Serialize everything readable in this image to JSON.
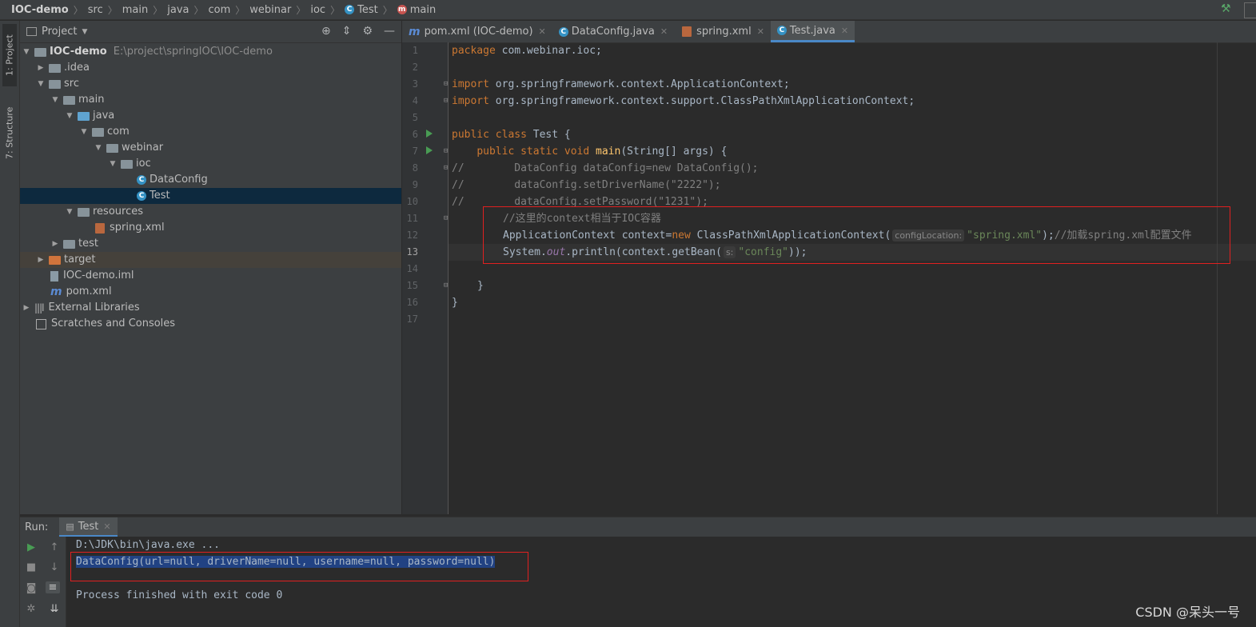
{
  "breadcrumb": {
    "items": [
      "IOC-demo",
      "src",
      "main",
      "java",
      "com",
      "webinar",
      "ioc",
      "Test",
      "main"
    ]
  },
  "toolstrip": {
    "project_tab": "1: Project",
    "structure_tab": "7: Structure"
  },
  "project_panel": {
    "title": "Project",
    "tree": [
      {
        "label": "IOC-demo",
        "path": "E:\\project\\springIOC\\IOC-demo"
      },
      {
        "label": ".idea"
      },
      {
        "label": "src"
      },
      {
        "label": "main"
      },
      {
        "label": "java"
      },
      {
        "label": "com"
      },
      {
        "label": "webinar"
      },
      {
        "label": "ioc"
      },
      {
        "label": "DataConfig"
      },
      {
        "label": "Test"
      },
      {
        "label": "resources"
      },
      {
        "label": "spring.xml"
      },
      {
        "label": "test"
      },
      {
        "label": "target"
      },
      {
        "label": "IOC-demo.iml"
      },
      {
        "label": "pom.xml"
      },
      {
        "label": "External Libraries"
      },
      {
        "label": "Scratches and Consoles"
      }
    ]
  },
  "editor": {
    "tabs": [
      {
        "label": "pom.xml (IOC-demo)",
        "active": false
      },
      {
        "label": "DataConfig.java",
        "active": false
      },
      {
        "label": "spring.xml",
        "active": false
      },
      {
        "label": "Test.java",
        "active": true
      }
    ],
    "line_numbers": [
      "1",
      "2",
      "3",
      "4",
      "5",
      "6",
      "7",
      "8",
      "9",
      "10",
      "11",
      "12",
      "13",
      "14",
      "15",
      "16",
      "17"
    ],
    "code": {
      "l1_kw": "package",
      "l1_rest": " com.webinar.ioc;",
      "l3_kw": "import",
      "l3_rest": " org.springframework.context.ApplicationContext;",
      "l4_kw": "import",
      "l4_rest": " org.springframework.context.support.ClassPathXmlApplicationContext;",
      "l6_kw": "public class",
      "l6_rest": " Test {",
      "l7_kw": "public static void",
      "l7_fn": "main",
      "l7_rest": "(String[] args) {",
      "l8": "//        DataConfig dataConfig=new DataConfig();",
      "l9": "//        dataConfig.setDriverName(\"2222\");",
      "l10": "//        dataConfig.setPassword(\"1231\");",
      "l11": "//这里的context相当于IOC容器",
      "l12_a": "ApplicationContext context=",
      "l12_kw": "new",
      "l12_b": " ClassPathXmlApplicationContext(",
      "l12_hint": "configLocation:",
      "l12_str": "\"spring.xml\"",
      "l12_c": ");",
      "l12_cmt": "//加载spring.xml配置文件",
      "l13_a": "System.",
      "l13_out": "out",
      "l13_b": ".println(context.getBean(",
      "l13_hint": "s:",
      "l13_str": "\"config\"",
      "l13_c": "));",
      "l15": "}",
      "l16": "}"
    }
  },
  "run_panel": {
    "label": "Run:",
    "tab": "Test",
    "lines": {
      "cmd": "D:\\JDK\\bin\\java.exe ...",
      "output": "DataConfig(url=null, driverName=null, username=null, password=null)",
      "exit": "Process finished with exit code 0"
    }
  },
  "watermark": "CSDN @呆头一号",
  "colors": {
    "keyword": "#cc7832",
    "string": "#6a8759",
    "comment": "#808080",
    "annotation_box": "#e02020",
    "selection": "#214283"
  }
}
